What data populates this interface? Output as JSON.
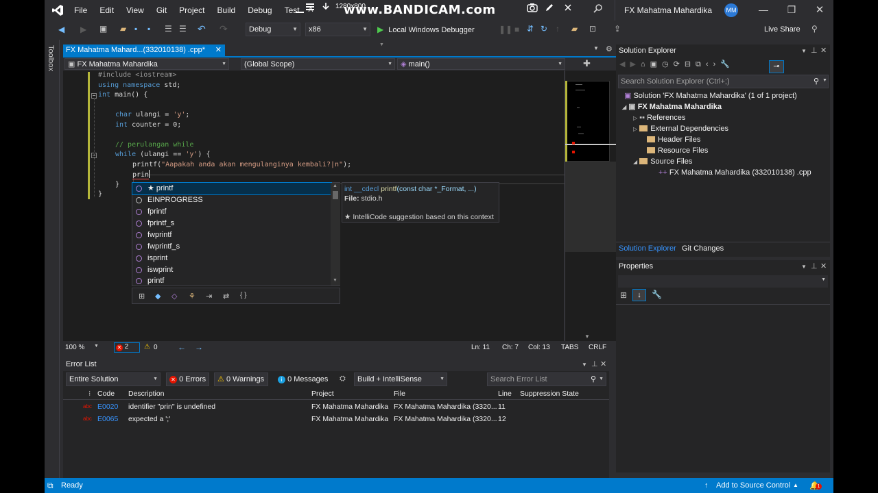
{
  "menu": {
    "items": [
      "File",
      "Edit",
      "View",
      "Git",
      "Project",
      "Build",
      "Debug",
      "Test"
    ],
    "more": "A"
  },
  "recording": {
    "resolution": "1280x800",
    "watermark": "www.BANDICAM.com"
  },
  "title": {
    "text": "FX Mahatma Mahardika",
    "avatar": "MM"
  },
  "toolbar": {
    "config": "Debug",
    "platform": "x86",
    "debugger": "Local Windows Debugger",
    "live_share": "Live Share"
  },
  "toolbox_label": "Toolbox",
  "document_tab": {
    "label": "FX Mahatma Mahard...(332010138) .cpp*"
  },
  "navbar": {
    "project": "FX Mahatma Mahardika",
    "scope": "(Global Scope)",
    "member": "main()"
  },
  "code": {
    "l1_pp": "#include ",
    "l1_inc": "<iostream>",
    "l2_kw1": "using",
    "l2_kw2": " namespace",
    "l2_rest": " std;",
    "l3_kw": "int",
    "l3_rest": " main() {",
    "l5_kw": "char",
    "l5_mid": " ulangi = ",
    "l5_str": "'y'",
    "l5_end": ";",
    "l6_kw": "int",
    "l6_rest": " counter = 0;",
    "l8_cm": "// perulangan while",
    "l9_kw": "while",
    "l9_mid": " (ulangi == ",
    "l9_str": "'y'",
    "l9_end": ") {",
    "l10_fn": "printf(",
    "l10_str": "\"Aapakah anda akan mengulanginya kembali?|n\"",
    "l10_end": ");",
    "l11": "prin",
    "l12": "}",
    "l13": "}"
  },
  "completion": {
    "items": [
      {
        "label": "★ printf",
        "selected": true
      },
      {
        "label": "EINPROGRESS"
      },
      {
        "label": "fprintf"
      },
      {
        "label": "fprintf_s"
      },
      {
        "label": "fwprintf"
      },
      {
        "label": "fwprintf_s"
      },
      {
        "label": "isprint"
      },
      {
        "label": "iswprint"
      },
      {
        "label": "printf"
      }
    ]
  },
  "tooltip": {
    "signature_kw": "int __cdecl ",
    "signature_fn": "printf",
    "signature_args": "(const char *_Format, ...)",
    "file_label": "File:",
    "file_value": " stdio.h",
    "intellicode": "★ IntelliCode suggestion based on this context"
  },
  "editor_status": {
    "zoom": "100 %",
    "errors": "2",
    "warnings": "0",
    "ln": "Ln: 11",
    "ch": "Ch: 7",
    "col": "Col: 13",
    "tabs": "TABS",
    "eol": "CRLF"
  },
  "solution_explorer": {
    "title": "Solution Explorer",
    "search_placeholder": "Search Solution Explorer (Ctrl+;)",
    "solution": "Solution 'FX Mahatma Mahardika' (1 of 1 project)",
    "project": "FX Mahatma Mahardika",
    "nodes": [
      "References",
      "External Dependencies",
      "Header Files",
      "Resource Files",
      "Source Files"
    ],
    "source_file": "FX Mahatma Mahardika (332010138) .cpp",
    "tab_active": "Solution Explorer",
    "tab_other": "Git Changes"
  },
  "properties": {
    "title": "Properties"
  },
  "error_list": {
    "title": "Error List",
    "scope": "Entire Solution",
    "errors_btn": "0 Errors",
    "warnings_btn": "0 Warnings",
    "messages_btn": "0 Messages",
    "build_filter": "Build + IntelliSense",
    "search_placeholder": "Search Error List",
    "columns": [
      "Code",
      "Description",
      "Project",
      "File",
      "Line",
      "Suppression State"
    ],
    "rows": [
      {
        "code": "E0020",
        "description": "identifier \"prin\" is undefined",
        "project": "FX Mahatma Mahardika",
        "file": "FX Mahatma Mahardika (3320...",
        "line": "11"
      },
      {
        "code": "E0065",
        "description": "expected a ';'",
        "project": "FX Mahatma Mahardika",
        "file": "FX Mahatma Mahardika (3320...",
        "line": "12"
      }
    ]
  },
  "statusbar": {
    "ready": "Ready",
    "source_control": "Add to Source Control",
    "notifications": "1"
  },
  "colors": {
    "accent": "#007acc",
    "chrome": "#2d2d30",
    "editor": "#1e1e1e",
    "error": "#e51400"
  }
}
